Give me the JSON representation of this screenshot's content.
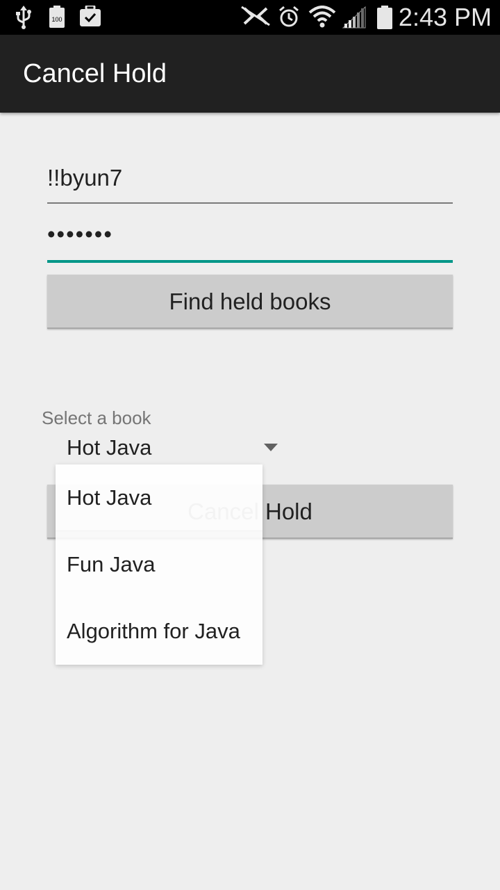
{
  "status_bar": {
    "time": "2:43 PM",
    "icons": [
      "usb-icon",
      "battery-100-notification-icon",
      "clipboard-check-icon",
      "nfc-muted-icon",
      "alarm-icon",
      "wifi-icon",
      "signal-icon",
      "battery-icon"
    ],
    "battery_badge": "100"
  },
  "app_bar": {
    "title": "Cancel Hold"
  },
  "form": {
    "username": "!!byun7",
    "password": "•••••••",
    "find_button_label": "Find held books"
  },
  "book_spinner": {
    "caption": "Select a book",
    "selected": "Hot Java",
    "options": [
      "Hot Java",
      "Fun Java",
      "Algorithm for Java"
    ]
  },
  "cancel_button_label": "Cancel Hold",
  "colors": {
    "focused_underline": "#009688",
    "app_bar": "#212121",
    "background": "#eeeeee",
    "button": "#cccccc"
  }
}
